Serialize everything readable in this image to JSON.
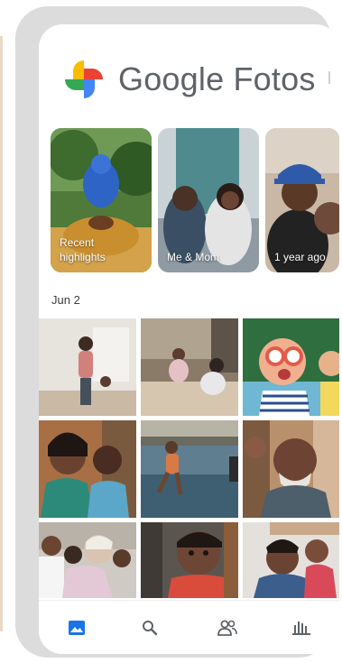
{
  "app": {
    "name": "Google Fotos",
    "icon": "google-photos-pinwheel-icon"
  },
  "highlights": [
    {
      "label": "Recent highlights",
      "scene": "child-on-shoulders"
    },
    {
      "label": "Me & Mom",
      "scene": "two-women-sofa"
    },
    {
      "label": "1 year ago",
      "scene": "couple-portrait"
    }
  ],
  "section": {
    "date": "Jun 2"
  },
  "photos": [
    "woman-and-child-living-room",
    "children-playing-floor",
    "child-with-glasses-laughing",
    "woman-smiling-with-friends",
    "person-jumping-into-lake",
    "grandfather-laughing",
    "grandmother-with-children",
    "smiling-child-closeup",
    "man-with-child-kiss"
  ],
  "nav": [
    {
      "name": "photos-tab",
      "icon": "photo-icon",
      "active": true
    },
    {
      "name": "search-tab",
      "icon": "search-icon",
      "active": false
    },
    {
      "name": "sharing-tab",
      "icon": "people-icon",
      "active": false
    },
    {
      "name": "library-tab",
      "icon": "library-icon",
      "active": false
    }
  ],
  "colors": {
    "accent": "#1a73e8",
    "text": "#5f6368",
    "frame": "#dcdcdc"
  }
}
